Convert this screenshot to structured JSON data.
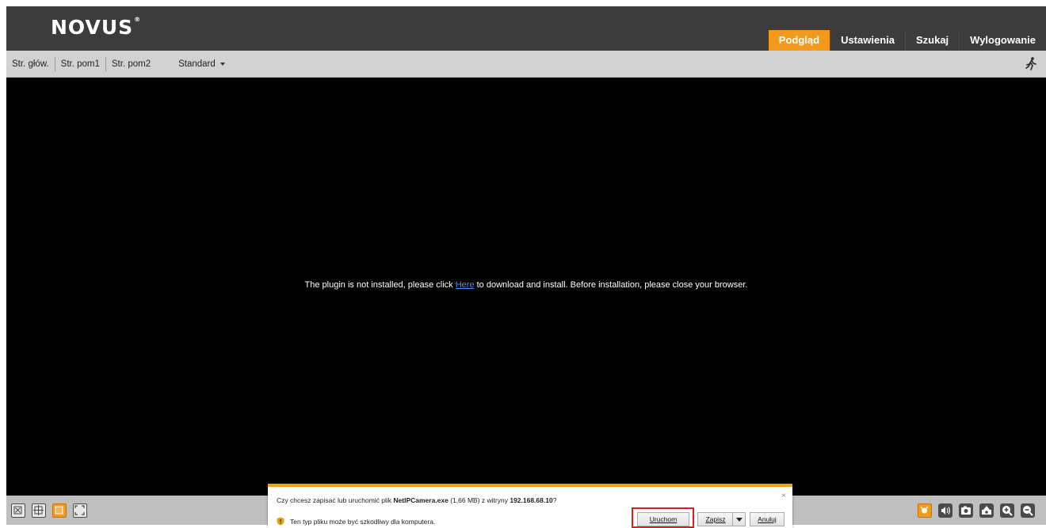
{
  "header": {
    "logo": "NOVUS",
    "logo_mark": "®",
    "tabs": [
      {
        "label": "Podgląd",
        "active": true
      },
      {
        "label": "Ustawienia",
        "active": false
      },
      {
        "label": "Szukaj",
        "active": false
      },
      {
        "label": "Wylogowanie",
        "active": false
      }
    ]
  },
  "subbar": {
    "streams": [
      "Str. głów.",
      "Str. pom1",
      "Str. pom2"
    ],
    "mode": "Standard",
    "icons": [
      "motion-runner-icon"
    ]
  },
  "video": {
    "msg_before": "The plugin is not installed, please click ",
    "msg_link": "Here",
    "msg_after": " to download and install. Before installation, please close your browser."
  },
  "bottom_bar": {
    "left_icons": [
      "close-view-icon",
      "window-split-icon",
      "window-layout-icon",
      "fullscreen-icon"
    ],
    "right_icons": [
      "live-view-icon",
      "audio-icon",
      "snapshot-icon",
      "record-icon",
      "zoom-in-icon",
      "zoom-out-icon"
    ]
  },
  "download_dialog": {
    "question_prefix": "Czy chcesz zapisać lub uruchomić plik ",
    "file_name": "NetIPCamera.exe",
    "file_info": " (1,66 MB) z witryny ",
    "site": "192.168.68.10",
    "question_suffix": "?",
    "warning": "Ten typ pliku może być szkodliwy dla komputera.",
    "run_label": "Uruchom",
    "save_label": "Zapisz",
    "cancel_label": "Anuluj",
    "close_symbol": "×"
  },
  "colors": {
    "accent": "#f39a1d",
    "header_bg": "#3c3c3c",
    "subbar_bg": "#d2d2d2",
    "highlight": "#e31b1b",
    "dialog_top": "#f0a30a"
  }
}
